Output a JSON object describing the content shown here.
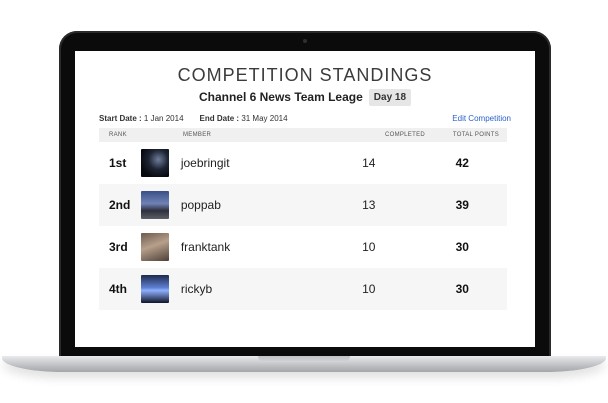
{
  "page": {
    "title": "COMPETITION STANDINGS",
    "competition_name": "Channel 6 News Team Leage",
    "day_badge": "Day 18",
    "start_date_label": "Start Date :",
    "start_date_value": "1 Jan 2014",
    "end_date_label": "End Date :",
    "end_date_value": "31 May 2014",
    "edit_link": "Edit Competition"
  },
  "table": {
    "headers": {
      "rank": "RANK",
      "member": "MEMBER",
      "completed": "COMPLETED",
      "total_points": "TOTAL POINTS"
    },
    "rows": [
      {
        "rank": "1st",
        "member": "joebringit",
        "completed": "14",
        "points": "42"
      },
      {
        "rank": "2nd",
        "member": "poppab",
        "completed": "13",
        "points": "39"
      },
      {
        "rank": "3rd",
        "member": "franktank",
        "completed": "10",
        "points": "30"
      },
      {
        "rank": "4th",
        "member": "rickyb",
        "completed": "10",
        "points": "30"
      }
    ]
  },
  "colors": {
    "link": "#2a62c9",
    "badge_bg": "#e6e6e6",
    "header_bg": "#f0f0f0",
    "alt_row_bg": "#f6f6f6"
  }
}
